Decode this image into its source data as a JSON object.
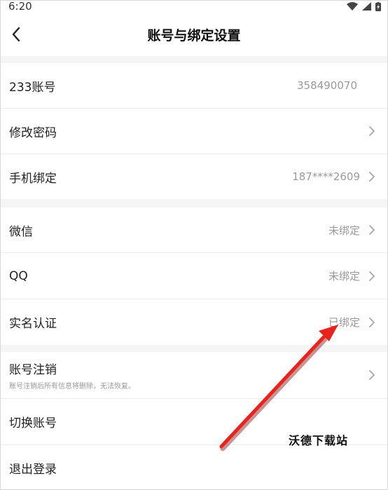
{
  "status_bar": {
    "time": "6:20"
  },
  "header": {
    "title": "账号与绑定设置"
  },
  "rows": {
    "account_id": {
      "label": "233账号",
      "value": "358490070"
    },
    "change_password": {
      "label": "修改密码"
    },
    "phone_binding": {
      "label": "手机绑定",
      "value": "187****2609"
    },
    "wechat": {
      "label": "微信",
      "value": "未绑定"
    },
    "qq": {
      "label": "QQ",
      "value": "未绑定"
    },
    "real_name": {
      "label": "实名认证",
      "value": "已绑定"
    },
    "cancel_account": {
      "label": "账号注销",
      "note": "账号注销后所有信息将删除，无法恢复。"
    },
    "switch_account": {
      "label": "切换账号"
    },
    "logout": {
      "label": "退出登录"
    }
  },
  "watermark": {
    "text": "沃德下载站"
  },
  "colors": {
    "background": "#f5f5f5",
    "row_background": "#ffffff",
    "secondary_text": "#9a9a9a",
    "annotation_arrow": "#e8231e"
  }
}
